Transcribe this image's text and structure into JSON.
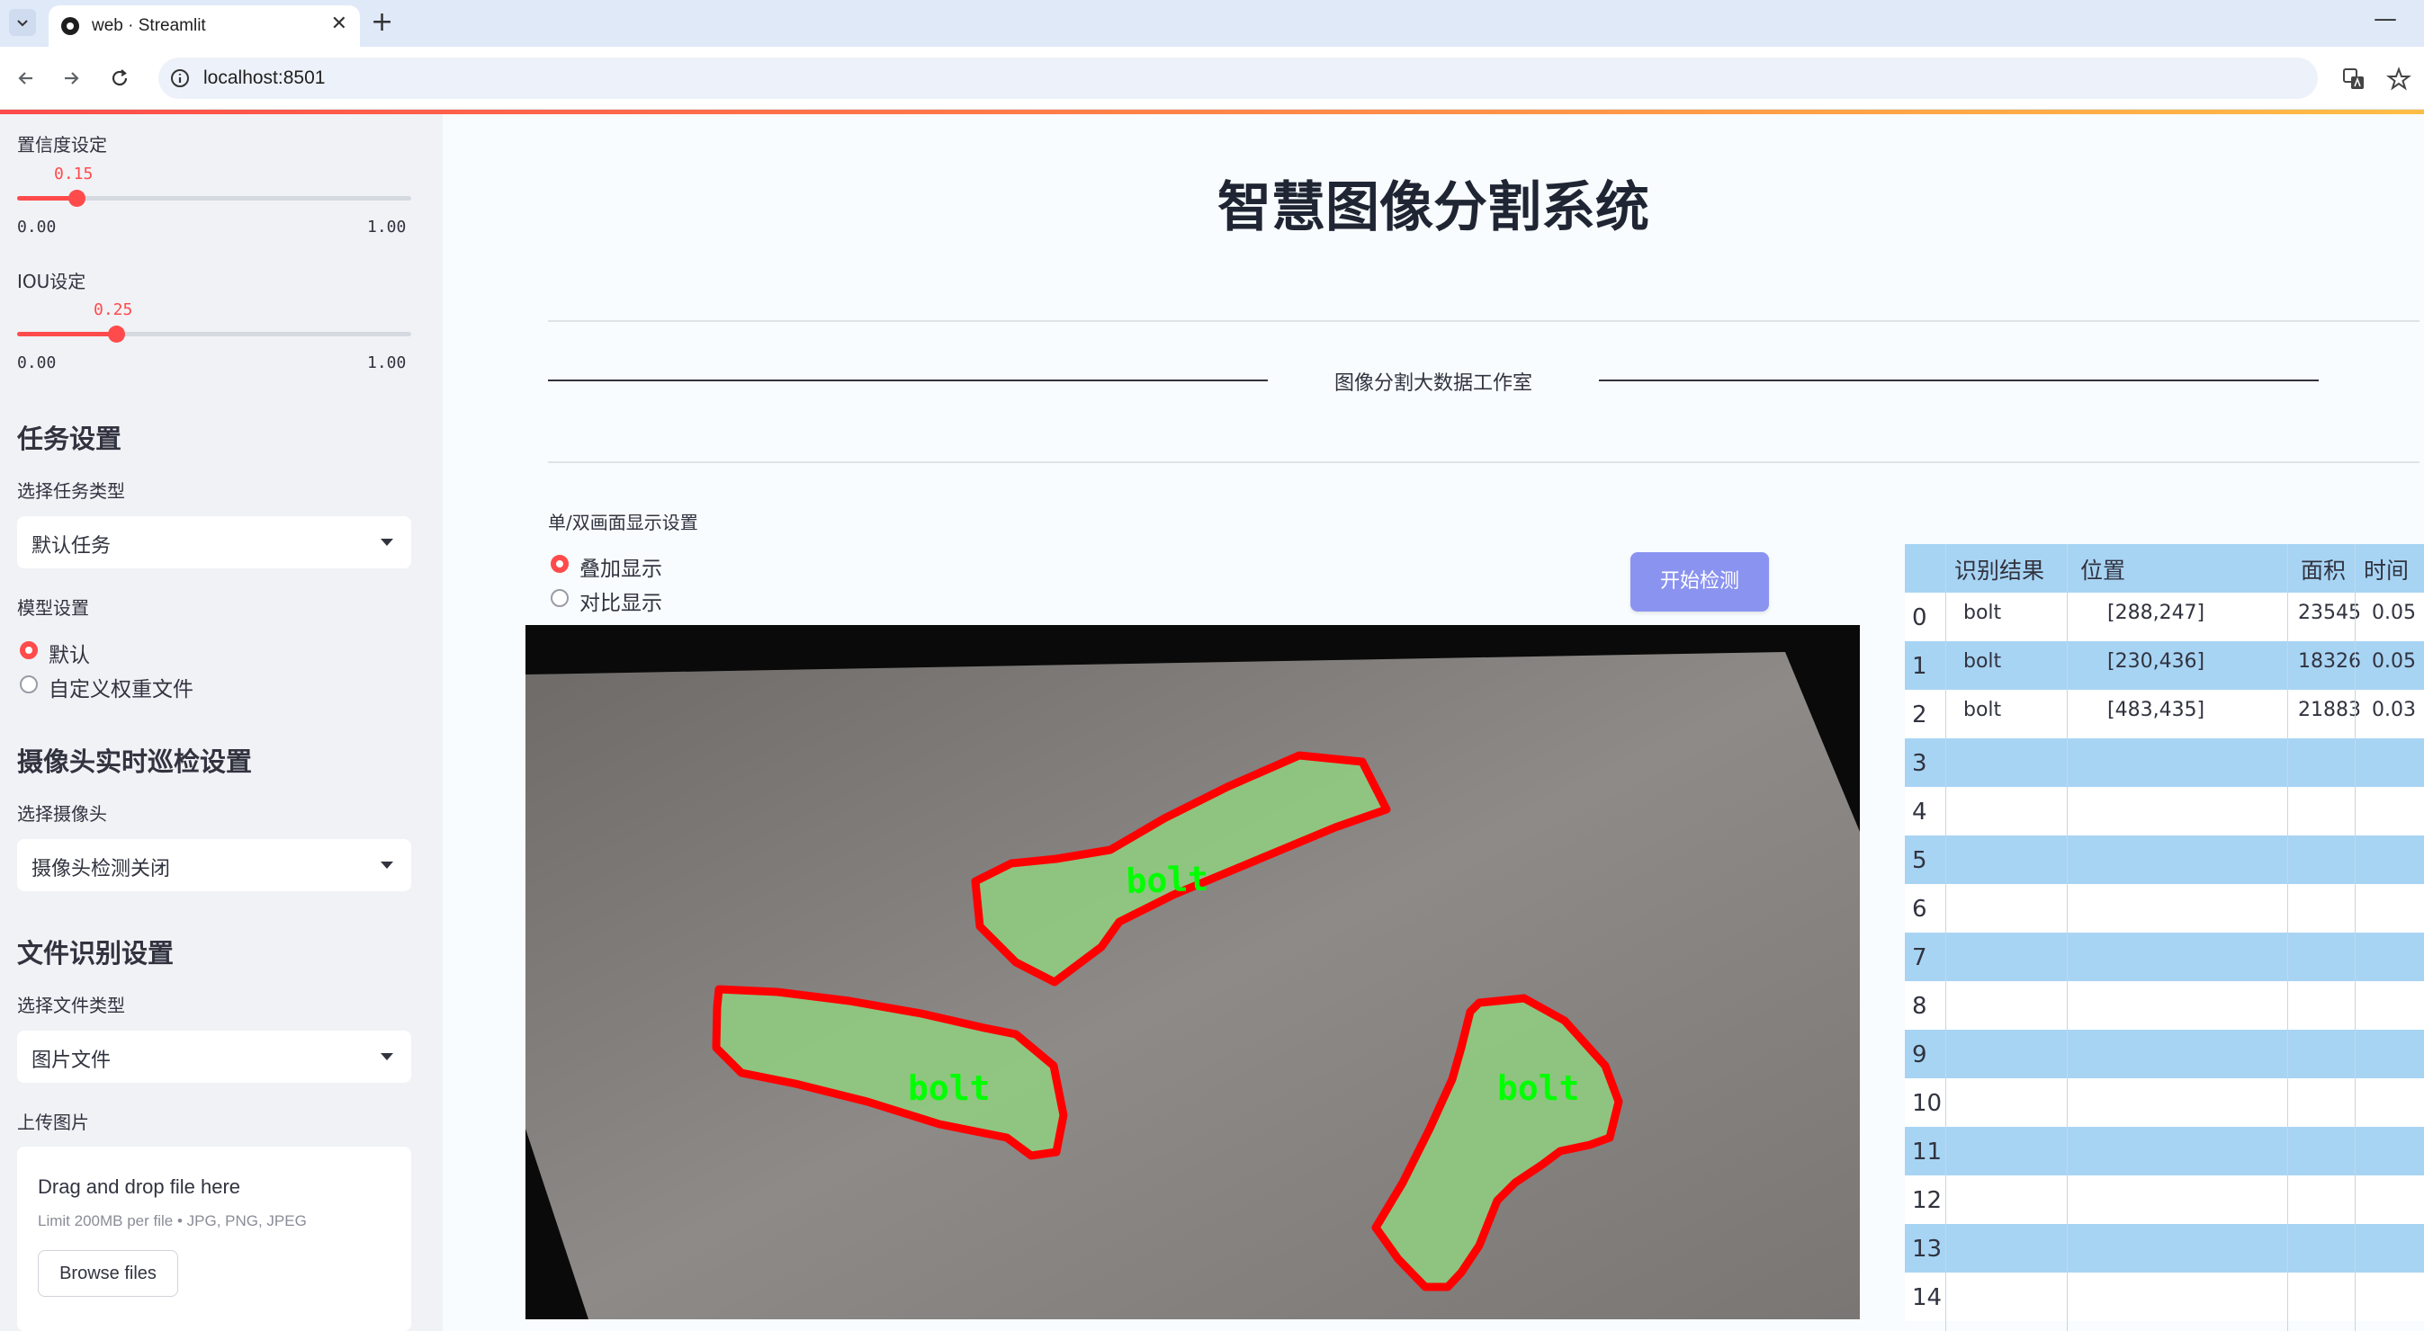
{
  "browser": {
    "tab_title": "web · Streamlit",
    "url": "localhost:8501"
  },
  "sidebar": {
    "confidence": {
      "label": "置信度设定",
      "value": "0.15",
      "fraction": 0.15,
      "min": "0.00",
      "max": "1.00"
    },
    "iou": {
      "label": "IOU设定",
      "value": "0.25",
      "fraction": 0.25,
      "min": "0.00",
      "max": "1.00"
    },
    "task_heading": "任务设置",
    "task_type_label": "选择任务类型",
    "task_type_value": "默认任务",
    "model_label": "模型设置",
    "model_options": [
      "默认",
      "自定义权重文件"
    ],
    "model_selected": "默认",
    "camera_heading": "摄像头实时巡检设置",
    "camera_label": "选择摄像头",
    "camera_value": "摄像头检测关闭",
    "file_heading": "文件识别设置",
    "file_type_label": "选择文件类型",
    "file_type_value": "图片文件",
    "upload_label": "上传图片",
    "upload_title": "Drag and drop file here",
    "upload_limit": "Limit 200MB per file • JPG, PNG, JPEG",
    "browse_label": "Browse files"
  },
  "main": {
    "title": "智慧图像分割系统",
    "studio_text": "图像分割大数据工作室",
    "display_label": "单/双画面显示设置",
    "display_options": [
      "叠加显示",
      "对比显示"
    ],
    "display_selected": "叠加显示",
    "detect_button": "开始检测",
    "detection_labels": [
      "bolt",
      "bolt",
      "bolt"
    ]
  },
  "table": {
    "headers": [
      "识别结果",
      "位置",
      "面积",
      "时间"
    ],
    "rows": [
      {
        "index": "0",
        "result": "bolt",
        "position": "[288,247]",
        "area": "23545",
        "time": "0.05"
      },
      {
        "index": "1",
        "result": "bolt",
        "position": "[230,436]",
        "area": "18326",
        "time": "0.05"
      },
      {
        "index": "2",
        "result": "bolt",
        "position": "[483,435]",
        "area": "21883",
        "time": "0.03"
      }
    ],
    "empty_indices": [
      "3",
      "4",
      "5",
      "6",
      "7",
      "8",
      "9",
      "10",
      "11",
      "12",
      "13",
      "14"
    ]
  },
  "colors": {
    "accent": "#ff4b4b",
    "button": "#8b93f0",
    "table_stripe": "#a8d4f4",
    "mask": "#90d080",
    "outline": "#ff0000",
    "label_text": "#00ff00"
  }
}
